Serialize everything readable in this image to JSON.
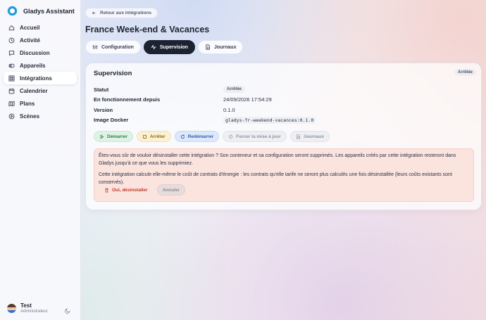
{
  "app": {
    "name": "Gladys Assistant"
  },
  "sidebar": {
    "items": [
      {
        "label": "Accueil",
        "icon": "home-icon"
      },
      {
        "label": "Activité",
        "icon": "clock-icon"
      },
      {
        "label": "Discussion",
        "icon": "chat-icon"
      },
      {
        "label": "Appareils",
        "icon": "devices-icon"
      },
      {
        "label": "Intégrations",
        "icon": "grid-icon",
        "active": true
      },
      {
        "label": "Calendrier",
        "icon": "calendar-icon"
      },
      {
        "label": "Plans",
        "icon": "map-icon"
      },
      {
        "label": "Scènes",
        "icon": "play-icon"
      }
    ]
  },
  "user": {
    "name": "Test",
    "role": "Administrateur"
  },
  "header": {
    "back_label": "Retour aux intégrations",
    "title": "France Week-end & Vacances"
  },
  "tabs": [
    {
      "label": "Configuration",
      "active": false
    },
    {
      "label": "Supervision",
      "active": true
    },
    {
      "label": "Journaux",
      "active": false
    }
  ],
  "card": {
    "title": "Supervision",
    "status_badge": "Arrêtée",
    "rows": [
      {
        "label": "Statut",
        "value": "Arrêtée"
      },
      {
        "label": "En fonctionnement depuis",
        "value": "24/09/2026 17:54:29"
      },
      {
        "label": "Version",
        "value": "0.1.0"
      },
      {
        "label": "Image Docker",
        "value": "gladys-fr-weekend-vacances:0.1.0"
      }
    ],
    "actions": {
      "start": "Démarrer",
      "stop": "Arrêter",
      "restart": "Redémarrer",
      "force_update": "Forcer la mise à jour",
      "logs": "Journaux"
    }
  },
  "confirm": {
    "message": "Êtes-vous sûr de vouloir désinstaller cette intégration ? Son conteneur et sa configuration seront supprimés. Les appareils créés par cette intégration resteront dans Gladys jusqu'à ce que vous les supprimiez.",
    "note": "Cette intégration calcule elle-même le coût de contrats d'énergie : les contrats qu'elle tarife ne seront plus calculés une fois désinstallée (leurs coûts existants sont conservés).",
    "confirm_label": "Oui, désinstaller",
    "cancel_label": "Annuler"
  },
  "colors": {
    "accent": "#1c2230",
    "brand": "#1e9ad6",
    "danger": "#c0392b",
    "success": "#2e7d46",
    "warning": "#9a6a0e",
    "info": "#2c5fb3"
  }
}
